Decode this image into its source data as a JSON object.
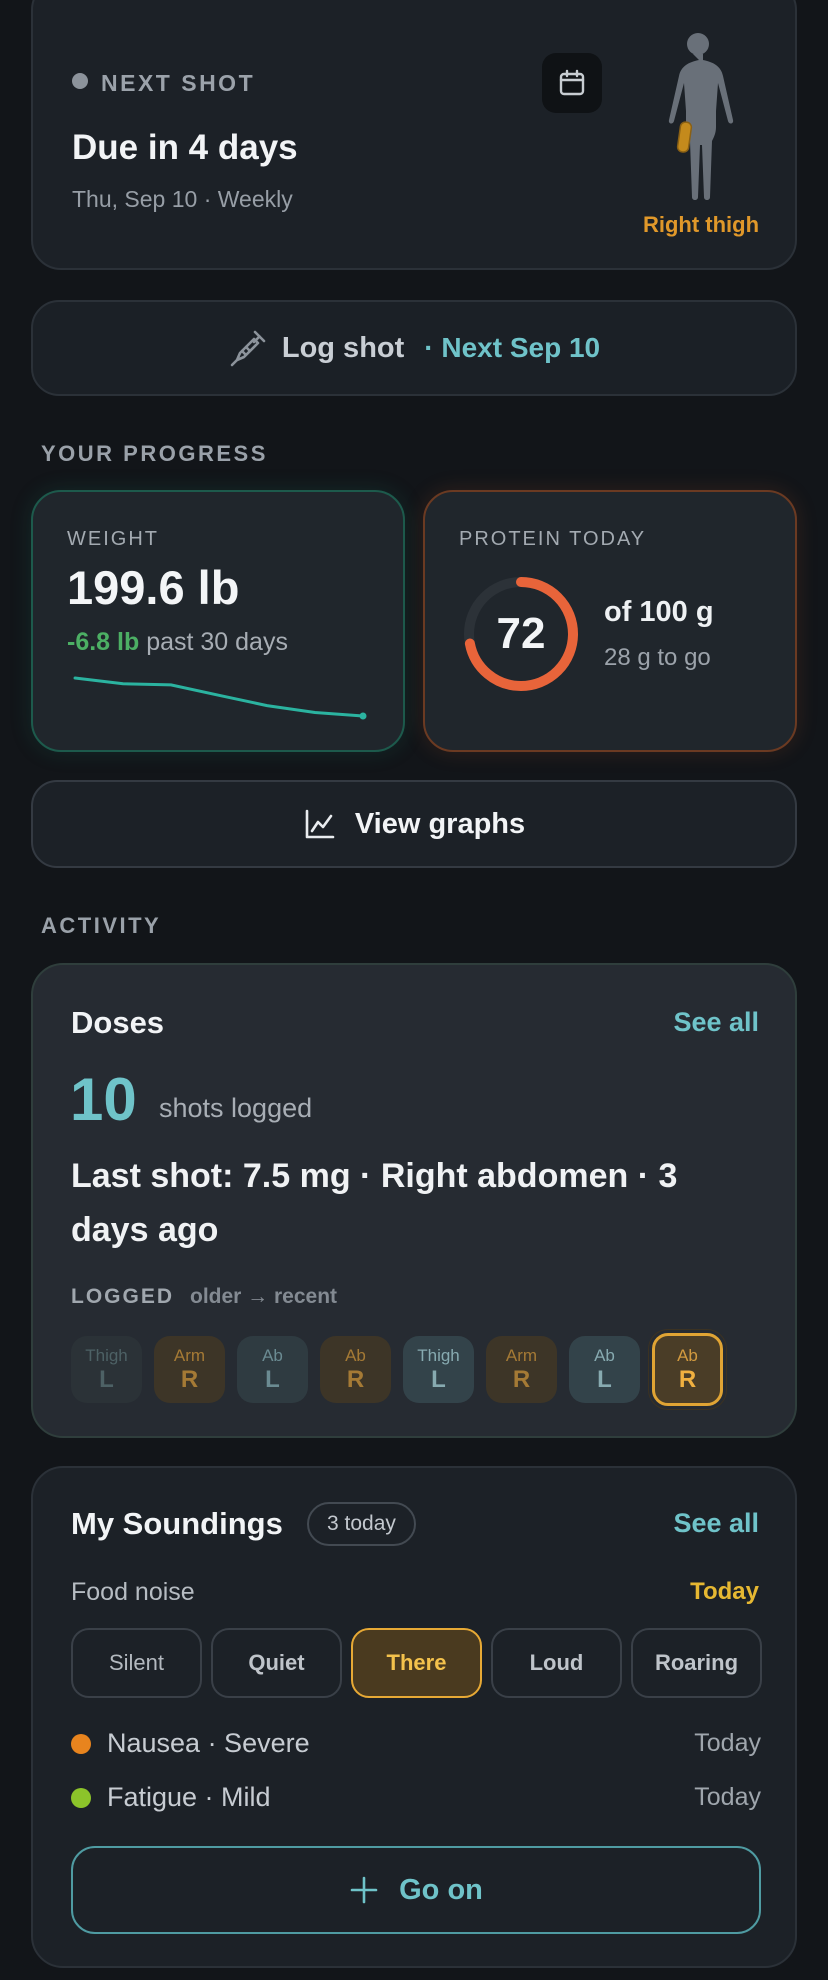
{
  "next_shot": {
    "label": "NEXT SHOT",
    "title": "Due in 4 days",
    "subtitle": "Thu, Sep 10 · Weekly",
    "site": "Right thigh"
  },
  "log_shot": {
    "label": "Log shot",
    "next": "· Next Sep 10"
  },
  "progress": {
    "section_label": "YOUR PROGRESS",
    "weight": {
      "label": "WEIGHT",
      "value": "199.6 lb",
      "change": "-6.8 lb",
      "change_period": "past 30 days",
      "trend": [
        204.5,
        204.0,
        203.9,
        203.0,
        202.1,
        201.5,
        201.2
      ]
    },
    "protein": {
      "label": "PROTEIN TODAY",
      "value": "72",
      "goal": "of 100 g",
      "remaining": "28 g to go",
      "fraction": 0.72
    }
  },
  "view_graphs": {
    "label": "View graphs"
  },
  "activity": {
    "section_label": "ACTIVITY",
    "doses": {
      "title": "Doses",
      "see_all": "See all",
      "count": "10",
      "count_label": "shots logged",
      "last_shot": "Last shot: 7.5 mg · Right abdomen · 3 days ago",
      "logged_label": "LOGGED",
      "logged_order": "older → recent",
      "chips": [
        {
          "loc": "Thigh",
          "side": "L"
        },
        {
          "loc": "Arm",
          "side": "R"
        },
        {
          "loc": "Ab",
          "side": "L"
        },
        {
          "loc": "Ab",
          "side": "R"
        },
        {
          "loc": "Thigh",
          "side": "L"
        },
        {
          "loc": "Arm",
          "side": "R"
        },
        {
          "loc": "Ab",
          "side": "L"
        },
        {
          "loc": "Ab",
          "side": "R"
        }
      ]
    }
  },
  "soundings": {
    "title": "My Soundings",
    "badge": "3 today",
    "see_all": "See all",
    "food_noise_label": "Food noise",
    "food_noise_time": "Today",
    "levels": [
      "Silent",
      "Quiet",
      "There",
      "Loud",
      "Roaring"
    ],
    "selected_level": "There",
    "symptoms": [
      {
        "text": "Nausea · Severe",
        "time": "Today",
        "color": "#e8841e"
      },
      {
        "text": "Fatigue · Mild",
        "time": "Today",
        "color": "#8cc42a"
      }
    ],
    "go_on": "Go on"
  },
  "colors": {
    "accent_teal": "#6fc3c9",
    "amber": "#e0a434",
    "protein_ring": "#e8643a",
    "weight_line": "#2bb3a0"
  }
}
